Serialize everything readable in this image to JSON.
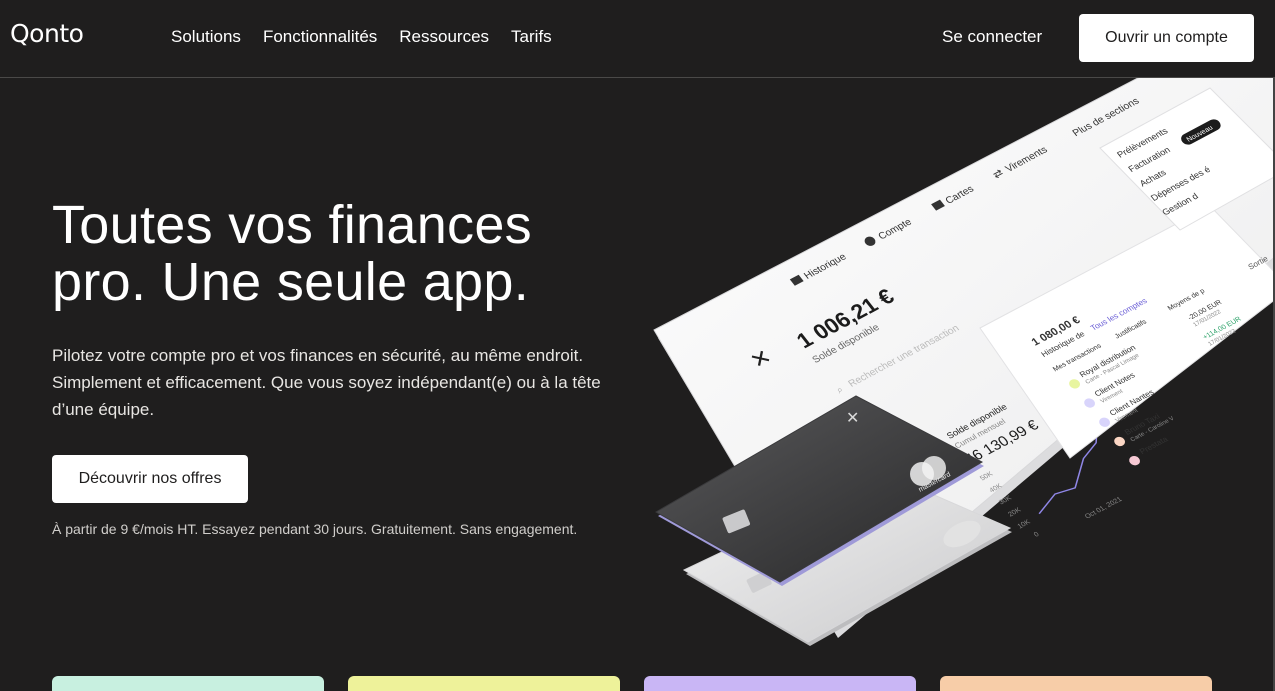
{
  "header": {
    "logo": "Qonto",
    "nav": [
      "Solutions",
      "Fonctionnalités",
      "Ressources",
      "Tarifs"
    ],
    "login": "Se connecter",
    "cta": "Ouvrir un compte"
  },
  "hero": {
    "title_line1": "Toutes vos finances",
    "title_line2": "pro. Une seule app.",
    "subtitle": "Pilotez votre compte pro et vos finances en sécurité, au même endroit. Simplement et efficacement. Que vous soyez indépendant(e) ou à la tête d’une équipe.",
    "cta": "Découvrir nos offres",
    "note": "À partir de 9 €/mois HT. Essayez pendant 30 jours. Gratuitement. Sans engagement."
  },
  "app_mockup": {
    "tabs": [
      "Historique",
      "Compte",
      "Cartes",
      "Virements",
      "Plus de sections"
    ],
    "menu": [
      "Prélèvements",
      "Facturation",
      "Achats",
      "Dépenses des é",
      "Gestion d"
    ],
    "menu_badge": "Nouveau",
    "balance": "1 006,21 €",
    "balance_label": "Solde disponible",
    "search_placeholder": "Rechercher une transaction",
    "chart_balance_label": "Solde disponible",
    "chart_balance_sub": "Cumul mensuel",
    "chart_balance": "46 130,99 €",
    "chart_ticks": [
      "50K",
      "40K",
      "30K",
      "20K",
      "10K",
      "0"
    ],
    "chart_date": "Oct 01, 2021",
    "panel_balance": "1 080,00 €",
    "panel_history": "Historique de",
    "panel_all_accounts": "Tous les comptes",
    "panel_filters": [
      "Mes transactions",
      "Justificatifs",
      "Moyens de p"
    ],
    "transactions": [
      {
        "name": "Royal distribution",
        "sub": "Carte - Pascal Limage",
        "amount": "-20,00 EUR",
        "date": "17/01/2022"
      },
      {
        "name": "Client Notes",
        "sub": "Virement",
        "amount": "+114,00 EUR",
        "date": "17/01/2022"
      },
      {
        "name": "Client Nantes",
        "sub": "Virement",
        "amount": "",
        "date": ""
      },
      {
        "name": "Bruno Taxi",
        "sub": "Carte - Caroline V",
        "amount": "",
        "date": ""
      },
      {
        "name": "Prestata",
        "sub": "",
        "amount": "",
        "date": ""
      }
    ],
    "sort_label": "Sortie",
    "card_brand": "mastercard"
  },
  "colors": {
    "background": "#1f1e1e",
    "card_mint": "#c8f0e0",
    "card_lime": "#eef29a",
    "card_lavender": "#c9b6f5",
    "card_peach": "#f7cda8"
  }
}
